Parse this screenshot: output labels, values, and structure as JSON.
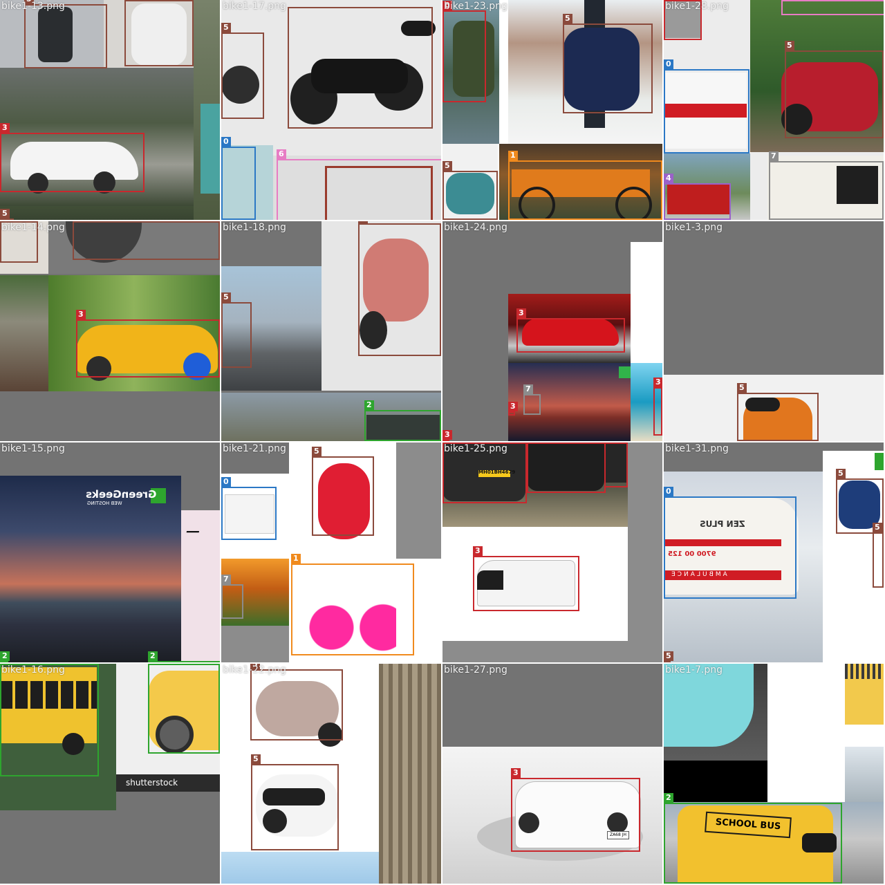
{
  "colors": {
    "class0": "#2b78c5",
    "class1": "#f08a1d",
    "class2": "#2ea52e",
    "class3": "#c9282d",
    "class4": "#9a62c8",
    "class5": "#8b4a3c",
    "class6": "#e77cc4",
    "class7": "#8c8c8c",
    "pad": "#737373"
  },
  "tiles": [
    {
      "filename": "bike1-13.png",
      "labels": [
        "5",
        "3",
        "5"
      ]
    },
    {
      "filename": "bike1-17.png",
      "labels": [
        "5",
        "0",
        "6"
      ]
    },
    {
      "filename": "bike1-23.png",
      "labels": [
        "0",
        "5",
        "5",
        "1"
      ]
    },
    {
      "filename": "bike1-28.png",
      "labels": [
        "5",
        "0",
        "4",
        "7"
      ]
    },
    {
      "filename": "bike1-14.png",
      "labels": [
        "5",
        "5",
        "3"
      ]
    },
    {
      "filename": "bike1-18.png",
      "labels": [
        "5",
        "5",
        "2"
      ]
    },
    {
      "filename": "bike1-24.png",
      "labels": [
        "3",
        "7",
        "3",
        "3",
        "3"
      ]
    },
    {
      "filename": "bike1-3.png",
      "labels": [
        "5"
      ]
    },
    {
      "filename": "bike1-15.png",
      "labels": [
        "2",
        "2"
      ],
      "watermark_brand": "GreenGeeks",
      "watermark_sub": "WEB HOSTING"
    },
    {
      "filename": "bike1-21.png",
      "labels": [
        "5",
        "0",
        "7",
        "1"
      ]
    },
    {
      "filename": "bike1-25.png",
      "labels": [
        "3",
        "3",
        "3",
        "3"
      ],
      "plate_text": "MH01BH4679"
    },
    {
      "filename": "bike1-31.png",
      "labels": [
        "0",
        "5",
        "5",
        "5"
      ],
      "van_text": "ZEN PLUS",
      "van_phone": "9700 00 125",
      "van_side": "AMBULANCE"
    },
    {
      "filename": "bike1-16.png",
      "labels": [
        "2",
        "2"
      ],
      "watermark": "shutterstock"
    },
    {
      "filename": "bike1-22.png",
      "labels": [
        "5",
        "5"
      ]
    },
    {
      "filename": "bike1-27.png",
      "labels": [
        "3"
      ],
      "plate_text": "ZA68 JH"
    },
    {
      "filename": "bike1-7.png",
      "labels": [
        "2"
      ],
      "bus_sign": "SCHOOL BUS"
    }
  ]
}
